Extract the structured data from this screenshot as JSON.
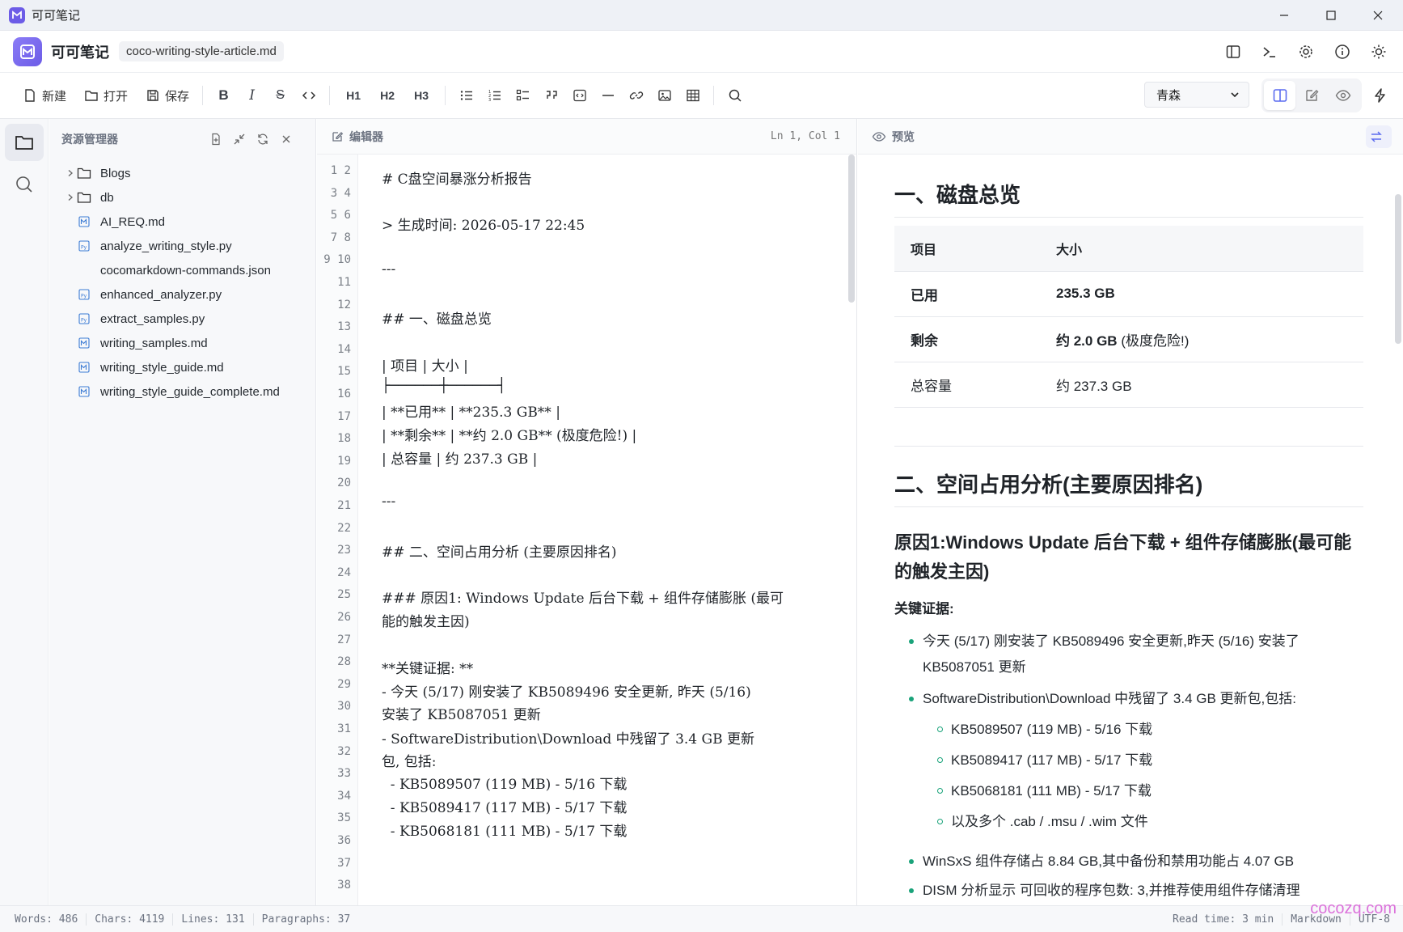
{
  "window": {
    "title": "可可笔记"
  },
  "header": {
    "app_name": "可可笔记",
    "file_name": "coco-writing-style-article.md"
  },
  "toolbar": {
    "new_label": "新建",
    "open_label": "打开",
    "save_label": "保存",
    "h1": "H1",
    "h2": "H2",
    "h3": "H3",
    "theme_value": "青森"
  },
  "explorer": {
    "title": "资源管理器",
    "items": [
      {
        "name": "Blogs",
        "type": "folder"
      },
      {
        "name": "db",
        "type": "folder"
      },
      {
        "name": "AI_REQ.md",
        "type": "md"
      },
      {
        "name": "analyze_writing_style.py",
        "type": "py"
      },
      {
        "name": "cocomarkdown-commands.json",
        "type": "json"
      },
      {
        "name": "enhanced_analyzer.py",
        "type": "py"
      },
      {
        "name": "extract_samples.py",
        "type": "py"
      },
      {
        "name": "writing_samples.md",
        "type": "md"
      },
      {
        "name": "writing_style_guide.md",
        "type": "md"
      },
      {
        "name": "writing_style_guide_complete.md",
        "type": "md"
      }
    ]
  },
  "editor": {
    "title": "编辑器",
    "cursor": "Ln 1, Col 1",
    "gutter": [
      "1 2",
      "3 4",
      "5 6",
      "7 8",
      "9 10",
      "11",
      "12",
      "13",
      "14",
      "15",
      "16",
      "17",
      "18",
      "19",
      "20",
      "21",
      "22",
      "23",
      "24",
      "25",
      "26",
      "27",
      "28",
      "29",
      "30",
      "31",
      "32",
      "33",
      "34",
      "35",
      "36",
      "37",
      "38"
    ],
    "lines": [
      "# C盘空间暴涨分析报告",
      "> 生成时间: 2026-05-17 22:45",
      "---",
      "## 一、磁盘总览",
      "| 项目 | 大小 |",
      "├──────┼──────┤",
      "| **已用** | **235.3 GB** |",
      "| **剩余** | **约 2.0 GB** (极度危险!) |",
      "| 总容量 | 约 237.3 GB |",
      "---",
      "## 二、空间占用分析 (主要原因排名)",
      "### 原因1: Windows Update 后台下载 + 组件存储膨胀 (最可",
      "能的触发主因)",
      "**关键证据: **",
      "- 今天 (5/17) 刚安装了 KB5089496 安全更新, 昨天 (5/16)",
      "安装了 KB5087051 更新",
      "- SoftwareDistribution\\Download 中残留了 3.4 GB 更新",
      "包, 包括:",
      "  - KB5089507 (119 MB) - 5/16 下载",
      "  - KB5089417 (117 MB) - 5/17 下载",
      "  - KB5068181 (111 MB) - 5/17 下载"
    ]
  },
  "preview": {
    "title": "预览",
    "h2_disk": "一、磁盘总览",
    "table": {
      "headers": [
        "项目",
        "大小"
      ],
      "rows": [
        {
          "k": "已用",
          "v": "235.3 GB",
          "extra": ""
        },
        {
          "k": "剩余",
          "v": "约 2.0 GB",
          "extra": " (极度危险!)"
        },
        {
          "k": "总容量",
          "v": "约 237.3 GB",
          "extra": ""
        }
      ]
    },
    "h2_space": "二、空间占用分析(主要原因排名)",
    "h3_reason1": "原因1:Windows Update 后台下载 + 组件存储膨胀(最可能的触发主因)",
    "evidence_label": "关键证据:",
    "bullets": [
      "今天 (5/17) 刚安装了 KB5089496 安全更新,昨天 (5/16) 安装了 KB5087051 更新",
      "SoftwareDistribution\\Download 中残留了 3.4 GB 更新包,包括:"
    ],
    "sub_bullets": [
      "KB5089507 (119 MB) - 5/16 下载",
      "KB5089417 (117 MB) - 5/17 下载",
      "KB5068181 (111 MB) - 5/17 下载",
      "以及多个 .cab / .msu / .wim 文件"
    ],
    "bullets_after": [
      "WinSxS 组件存储占 8.84 GB,其中备份和禁用功能占 4.07 GB",
      "DISM 分析显示 可回收的程序包数: 3,并推荐使用组件存储清理"
    ]
  },
  "status": {
    "words": "Words: 486",
    "chars": "Chars: 4119",
    "lines": "Lines: 131",
    "paragraphs": "Paragraphs: 37",
    "read_time": "Read time: 3 min",
    "mode": "Markdown",
    "encoding": "UTF-8"
  },
  "watermark": "cocozq.com",
  "colors": {
    "accent": "#6c5ce7",
    "bullet": "#1aa37a"
  }
}
